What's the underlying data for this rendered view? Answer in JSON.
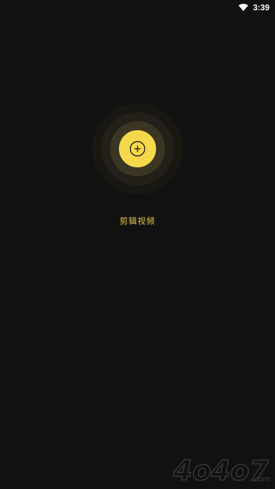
{
  "status_bar": {
    "time": "3:39",
    "wifi_icon": "wifi-icon"
  },
  "main": {
    "add_button_icon": "plus-circle-icon",
    "add_label": "剪辑视频"
  },
  "watermark": {
    "text": "4o4o7.com"
  },
  "colors": {
    "background": "#111111",
    "accent": "#f6d94a",
    "label": "#e8c84a"
  }
}
